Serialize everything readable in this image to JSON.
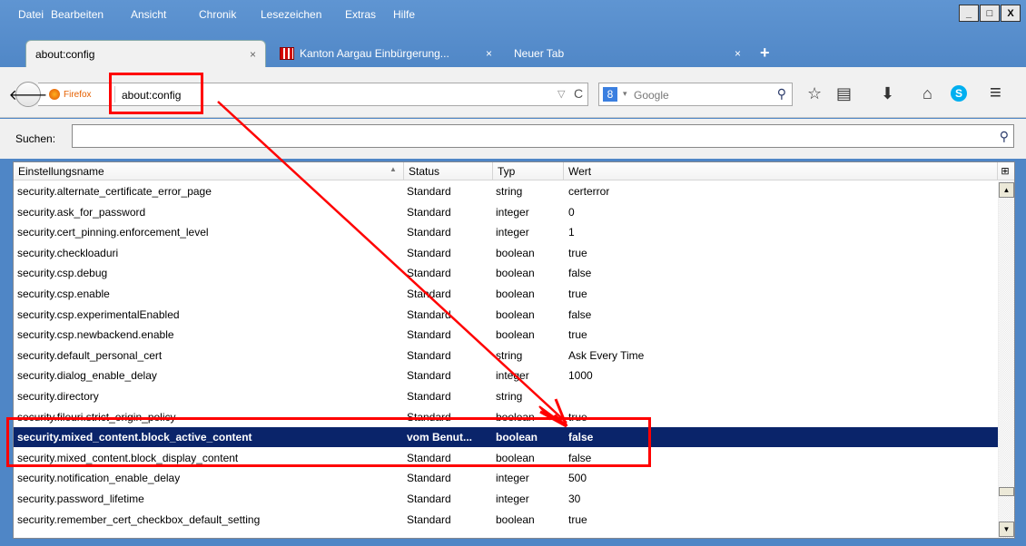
{
  "menubar": {
    "items": [
      {
        "label": "Datei"
      },
      {
        "label": "Bearbeiten"
      },
      {
        "label": "Ansicht"
      },
      {
        "label": "Chronik"
      },
      {
        "label": "Lesezeichen"
      },
      {
        "label": "Extras"
      },
      {
        "label": "Hilfe"
      }
    ]
  },
  "window_controls": {
    "minimize": "_",
    "maximize": "□",
    "close": "X"
  },
  "tabs": [
    {
      "label": "about:config",
      "active": true
    },
    {
      "label": "Kanton Aargau Einbürgerung...",
      "active": false
    },
    {
      "label": "Neuer Tab",
      "active": false
    }
  ],
  "tab_close": "×",
  "new_tab": "+",
  "navbar": {
    "back": "🡐",
    "identity": "Firefox",
    "url": "about:config",
    "url_dropdown": "▽",
    "reload": "C",
    "search_engine": "8",
    "search_engine_drop": "▾",
    "search_placeholder": "Google",
    "search_go": "⚲"
  },
  "toolbar_icons": {
    "bookmark": "☆",
    "bookmarks_list": "▤",
    "downloads": "⬇",
    "home": "⌂",
    "skype": "S",
    "menu": "≡"
  },
  "search": {
    "label": "Suchen:",
    "value": "",
    "icon": "⚲"
  },
  "table": {
    "headers": {
      "name": "Einstellungsname",
      "status": "Status",
      "type": "Typ",
      "value": "Wert"
    },
    "sort_indicator": "▲",
    "column_picker": "⊞",
    "rows": [
      {
        "name": "security.alternate_certificate_error_page",
        "status": "Standard",
        "type": "string",
        "value": "certerror"
      },
      {
        "name": "security.ask_for_password",
        "status": "Standard",
        "type": "integer",
        "value": "0"
      },
      {
        "name": "security.cert_pinning.enforcement_level",
        "status": "Standard",
        "type": "integer",
        "value": "1"
      },
      {
        "name": "security.checkloaduri",
        "status": "Standard",
        "type": "boolean",
        "value": "true"
      },
      {
        "name": "security.csp.debug",
        "status": "Standard",
        "type": "boolean",
        "value": "false"
      },
      {
        "name": "security.csp.enable",
        "status": "Standard",
        "type": "boolean",
        "value": "true"
      },
      {
        "name": "security.csp.experimentalEnabled",
        "status": "Standard",
        "type": "boolean",
        "value": "false"
      },
      {
        "name": "security.csp.newbackend.enable",
        "status": "Standard",
        "type": "boolean",
        "value": "true"
      },
      {
        "name": "security.default_personal_cert",
        "status": "Standard",
        "type": "string",
        "value": "Ask Every Time"
      },
      {
        "name": "security.dialog_enable_delay",
        "status": "Standard",
        "type": "integer",
        "value": "1000"
      },
      {
        "name": "security.directory",
        "status": "Standard",
        "type": "string",
        "value": ""
      },
      {
        "name": "security.fileuri.strict_origin_policy",
        "status": "Standard",
        "type": "boolean",
        "value": "true"
      },
      {
        "name": "security.mixed_content.block_active_content",
        "status": "vom Benut...",
        "type": "boolean",
        "value": "false",
        "selected": true
      },
      {
        "name": "security.mixed_content.block_display_content",
        "status": "Standard",
        "type": "boolean",
        "value": "false"
      },
      {
        "name": "security.notification_enable_delay",
        "status": "Standard",
        "type": "integer",
        "value": "500"
      },
      {
        "name": "security.password_lifetime",
        "status": "Standard",
        "type": "integer",
        "value": "30"
      },
      {
        "name": "security.remember_cert_checkbox_default_setting",
        "status": "Standard",
        "type": "boolean",
        "value": "true"
      }
    ]
  },
  "scrollbar": {
    "up": "▲",
    "down": "▼"
  },
  "colors": {
    "annotation": "#ff0000",
    "selection": "#0a246a"
  }
}
